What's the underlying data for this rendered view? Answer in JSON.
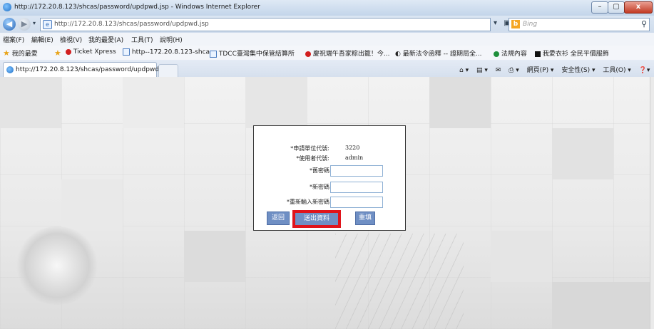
{
  "window": {
    "title": "http://172.20.8.123/shcas/password/updpwd.jsp - Windows Internet Explorer",
    "controls": {
      "minimize": "–",
      "maximize": "▢",
      "close": "x"
    }
  },
  "address_bar": {
    "url": "http://172.20.8.123/shcas/password/updpwd.jsp",
    "search_placeholder": "Bing"
  },
  "menu": [
    "檔案(F)",
    "編輯(E)",
    "檢視(V)",
    "我的最愛(A)",
    "工具(T)",
    "說明(H)"
  ],
  "favorites": {
    "label": "我的最愛",
    "items": [
      "Ticket Xpress",
      "http--172.20.8.123-shca...",
      "TDCC臺灣集中保管結算所",
      "慶祝端午吾家粽出籠！今...",
      "最新法令函釋 -- 證期局全...",
      "法規內容",
      "我愛衣衫 全民平價服飾"
    ]
  },
  "tabs": [
    {
      "label": "http://172.20.8.123/shcas/password/updpwd..."
    }
  ],
  "command_bar": [
    "網頁(P) ▾",
    "安全性(S) ▾",
    "工具(O) ▾"
  ],
  "form": {
    "fields": [
      {
        "label": "*申請單位代號:",
        "value": "3220"
      },
      {
        "label": "*使用者代號:",
        "value": "admin"
      },
      {
        "label": "*舊密碼",
        "value": ""
      },
      {
        "label": "*新密碼",
        "value": ""
      },
      {
        "label": "*重新輸入新密碼",
        "value": ""
      }
    ],
    "buttons": {
      "back": "返回",
      "submit": "送出資料",
      "reset": "重填"
    }
  },
  "colors": {
    "button_bg": "#6f8fc4",
    "highlight": "#e0141b"
  }
}
